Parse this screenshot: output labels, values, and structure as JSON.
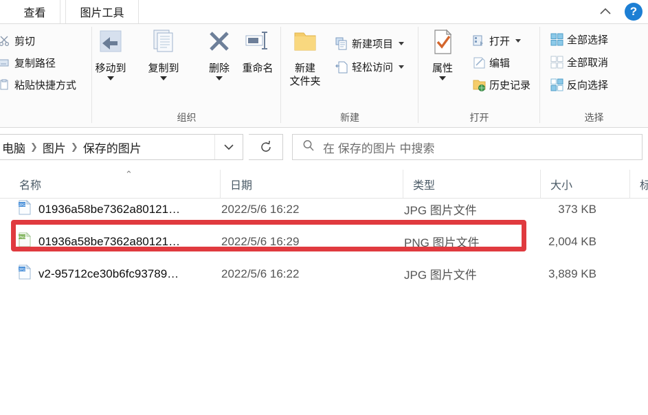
{
  "window": {
    "tabs": [
      {
        "id": "view",
        "label": "查看"
      },
      {
        "id": "picture-tools",
        "label": "图片工具"
      }
    ],
    "collapse_ribbon_icon": "chevron-up-icon",
    "help_label": "?"
  },
  "ribbon": {
    "groups": [
      {
        "id": "clipboard",
        "label": "",
        "items": [
          {
            "id": "cut",
            "label": "剪切",
            "icon": "scissors-icon"
          },
          {
            "id": "copy-path",
            "label": "复制路径",
            "icon": "copy-path-icon"
          },
          {
            "id": "paste-shortcut",
            "label": "粘贴快捷方式",
            "icon": "paste-shortcut-icon"
          }
        ]
      },
      {
        "id": "organize",
        "label": "组织",
        "buttons": [
          {
            "id": "move-to",
            "label": "移动到",
            "icon": "move-to-icon",
            "has_caret": true
          },
          {
            "id": "copy-to",
            "label": "复制到",
            "icon": "copy-to-icon",
            "has_caret": true
          },
          {
            "id": "delete",
            "label": "删除",
            "icon": "delete-x-icon",
            "has_caret": true
          },
          {
            "id": "rename",
            "label": "重命名",
            "icon": "rename-icon",
            "has_caret": false
          }
        ]
      },
      {
        "id": "new",
        "label": "新建",
        "big": {
          "id": "new-folder",
          "label_line1": "新建",
          "label_line2": "文件夹",
          "icon": "folder-icon"
        },
        "items": [
          {
            "id": "new-item",
            "label": "新建项目",
            "icon": "new-item-icon",
            "has_caret": true
          },
          {
            "id": "easy-access",
            "label": "轻松访问",
            "icon": "easy-access-icon",
            "has_caret": true
          }
        ]
      },
      {
        "id": "open",
        "label": "打开",
        "big": {
          "id": "properties",
          "label_line1": "属性",
          "label_line2": "",
          "icon": "properties-icon",
          "has_caret": true
        },
        "items": [
          {
            "id": "open",
            "label": "打开",
            "icon": "open-icon",
            "has_caret": true
          },
          {
            "id": "edit",
            "label": "编辑",
            "icon": "edit-pencil-icon",
            "has_caret": false
          },
          {
            "id": "history",
            "label": "历史记录",
            "icon": "history-icon",
            "has_caret": false
          }
        ]
      },
      {
        "id": "select",
        "label": "选择",
        "items": [
          {
            "id": "select-all",
            "label": "全部选择",
            "icon": "select-all-icon"
          },
          {
            "id": "select-none",
            "label": "全部取消",
            "icon": "select-none-icon"
          },
          {
            "id": "invert-selection",
            "label": "反向选择",
            "icon": "invert-selection-icon"
          }
        ]
      }
    ]
  },
  "addressbar": {
    "crumbs": [
      "电脑",
      "图片",
      "保存的图片"
    ],
    "separator": "❯",
    "dropdown_icon": "chevron-down-icon",
    "refresh_icon": "refresh-icon",
    "search": {
      "icon": "search-icon",
      "placeholder": "在 保存的图片 中搜索",
      "value": ""
    }
  },
  "filelist": {
    "columns": [
      {
        "id": "name",
        "label": "名称",
        "sorted": "asc",
        "sort_caret": "⌃"
      },
      {
        "id": "date",
        "label": "日期"
      },
      {
        "id": "type",
        "label": "类型"
      },
      {
        "id": "size",
        "label": "大小"
      },
      {
        "id": "tags",
        "label": "标"
      }
    ],
    "rows": [
      {
        "name": "01936a58be7362a80121…",
        "date": "2022/5/6 16:22",
        "type": "JPG 图片文件",
        "size": "373 KB",
        "icon": "jpg-file-icon",
        "highlighted": false
      },
      {
        "name": "01936a58be7362a80121…",
        "date": "2022/5/6 16:29",
        "type": "PNG 图片文件",
        "size": "2,004 KB",
        "icon": "png-file-icon",
        "highlighted": true
      },
      {
        "name": "v2-95712ce30b6fc93789…",
        "date": "2022/5/6 16:22",
        "type": "JPG 图片文件",
        "size": "3,889 KB",
        "icon": "jpg-file-icon",
        "highlighted": false
      }
    ]
  },
  "annotation": {
    "type": "rectangle-highlight",
    "color": "#e03a3f",
    "target_row_index": 1
  }
}
